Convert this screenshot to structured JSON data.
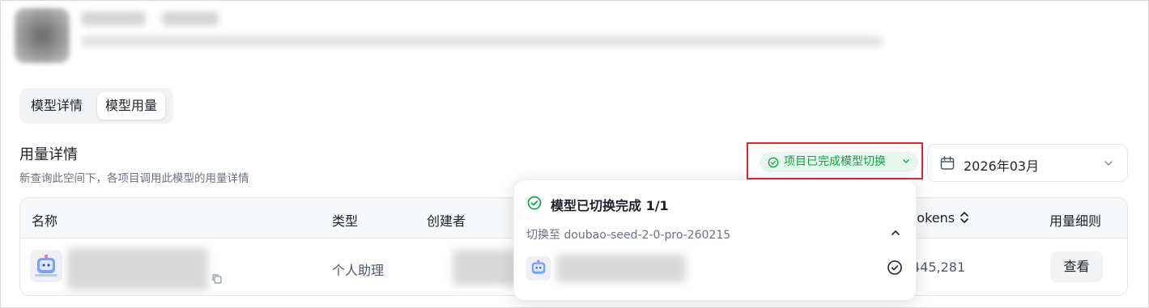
{
  "tabs": {
    "detail": "模型详情",
    "usage": "模型用量"
  },
  "section": {
    "title": "用量详情",
    "subtitle": "新查询此空间下，各项目调用此模型的用量详情"
  },
  "status_pill": {
    "label": "项目已完成模型切换",
    "color": "#14a247",
    "bg": "#e6f8ec"
  },
  "date_picker": {
    "value": "2026年03月"
  },
  "table": {
    "columns": {
      "name": "名称",
      "type": "类型",
      "creator": "创建者",
      "tokens": "tokens",
      "detail": "用量细则"
    },
    "rows": [
      {
        "type": "个人助理",
        "tokens": "445,281",
        "action": "查看"
      }
    ]
  },
  "popover": {
    "title": "模型已切换完成 1/1",
    "subtitle": "切换至 doubao-seed-2-0-pro-260215"
  },
  "accent": {
    "highlight_border": "#e5252a",
    "success": "#14a247"
  },
  "icons": [
    "check-circle-icon",
    "chevron-down-icon",
    "calendar-icon",
    "sort-icon",
    "copy-icon",
    "chevron-up-icon",
    "bot-avatar-icon"
  ]
}
